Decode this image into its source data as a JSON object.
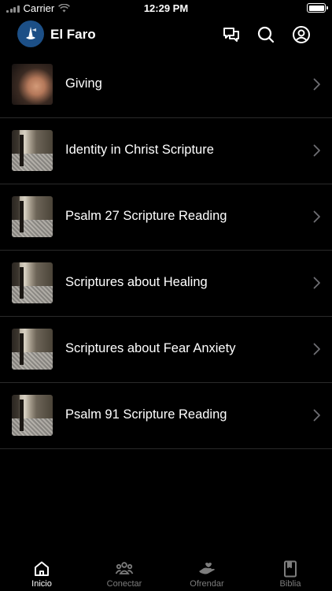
{
  "status_bar": {
    "carrier": "Carrier",
    "time": "12:29 PM"
  },
  "header": {
    "title": "El Faro",
    "icons": [
      "chat-icon",
      "search-icon",
      "profile-icon"
    ]
  },
  "items": [
    {
      "label": "Giving",
      "thumbnail": "open-hand-photo"
    },
    {
      "label": "Identity in Christ Scripture",
      "thumbnail": "scripture-photo"
    },
    {
      "label": "Psalm 27 Scripture Reading",
      "thumbnail": "scripture-photo"
    },
    {
      "label": "Scriptures about Healing",
      "thumbnail": "scripture-photo"
    },
    {
      "label": "Scriptures about Fear Anxiety",
      "thumbnail": "scripture-photo"
    },
    {
      "label": "Psalm 91 Scripture Reading",
      "thumbnail": "scripture-photo"
    }
  ],
  "tabs": [
    {
      "label": "Inicio",
      "icon": "home-icon",
      "active": true
    },
    {
      "label": "Conectar",
      "icon": "people-icon",
      "active": false
    },
    {
      "label": "Ofrendar",
      "icon": "giving-hand-icon",
      "active": false
    },
    {
      "label": "Biblia",
      "icon": "book-icon",
      "active": false
    }
  ],
  "colors": {
    "background": "#000000",
    "active_tab": "#ffffff",
    "inactive_tab": "#7d7d7d",
    "logo_bg": "#1c4f86"
  }
}
